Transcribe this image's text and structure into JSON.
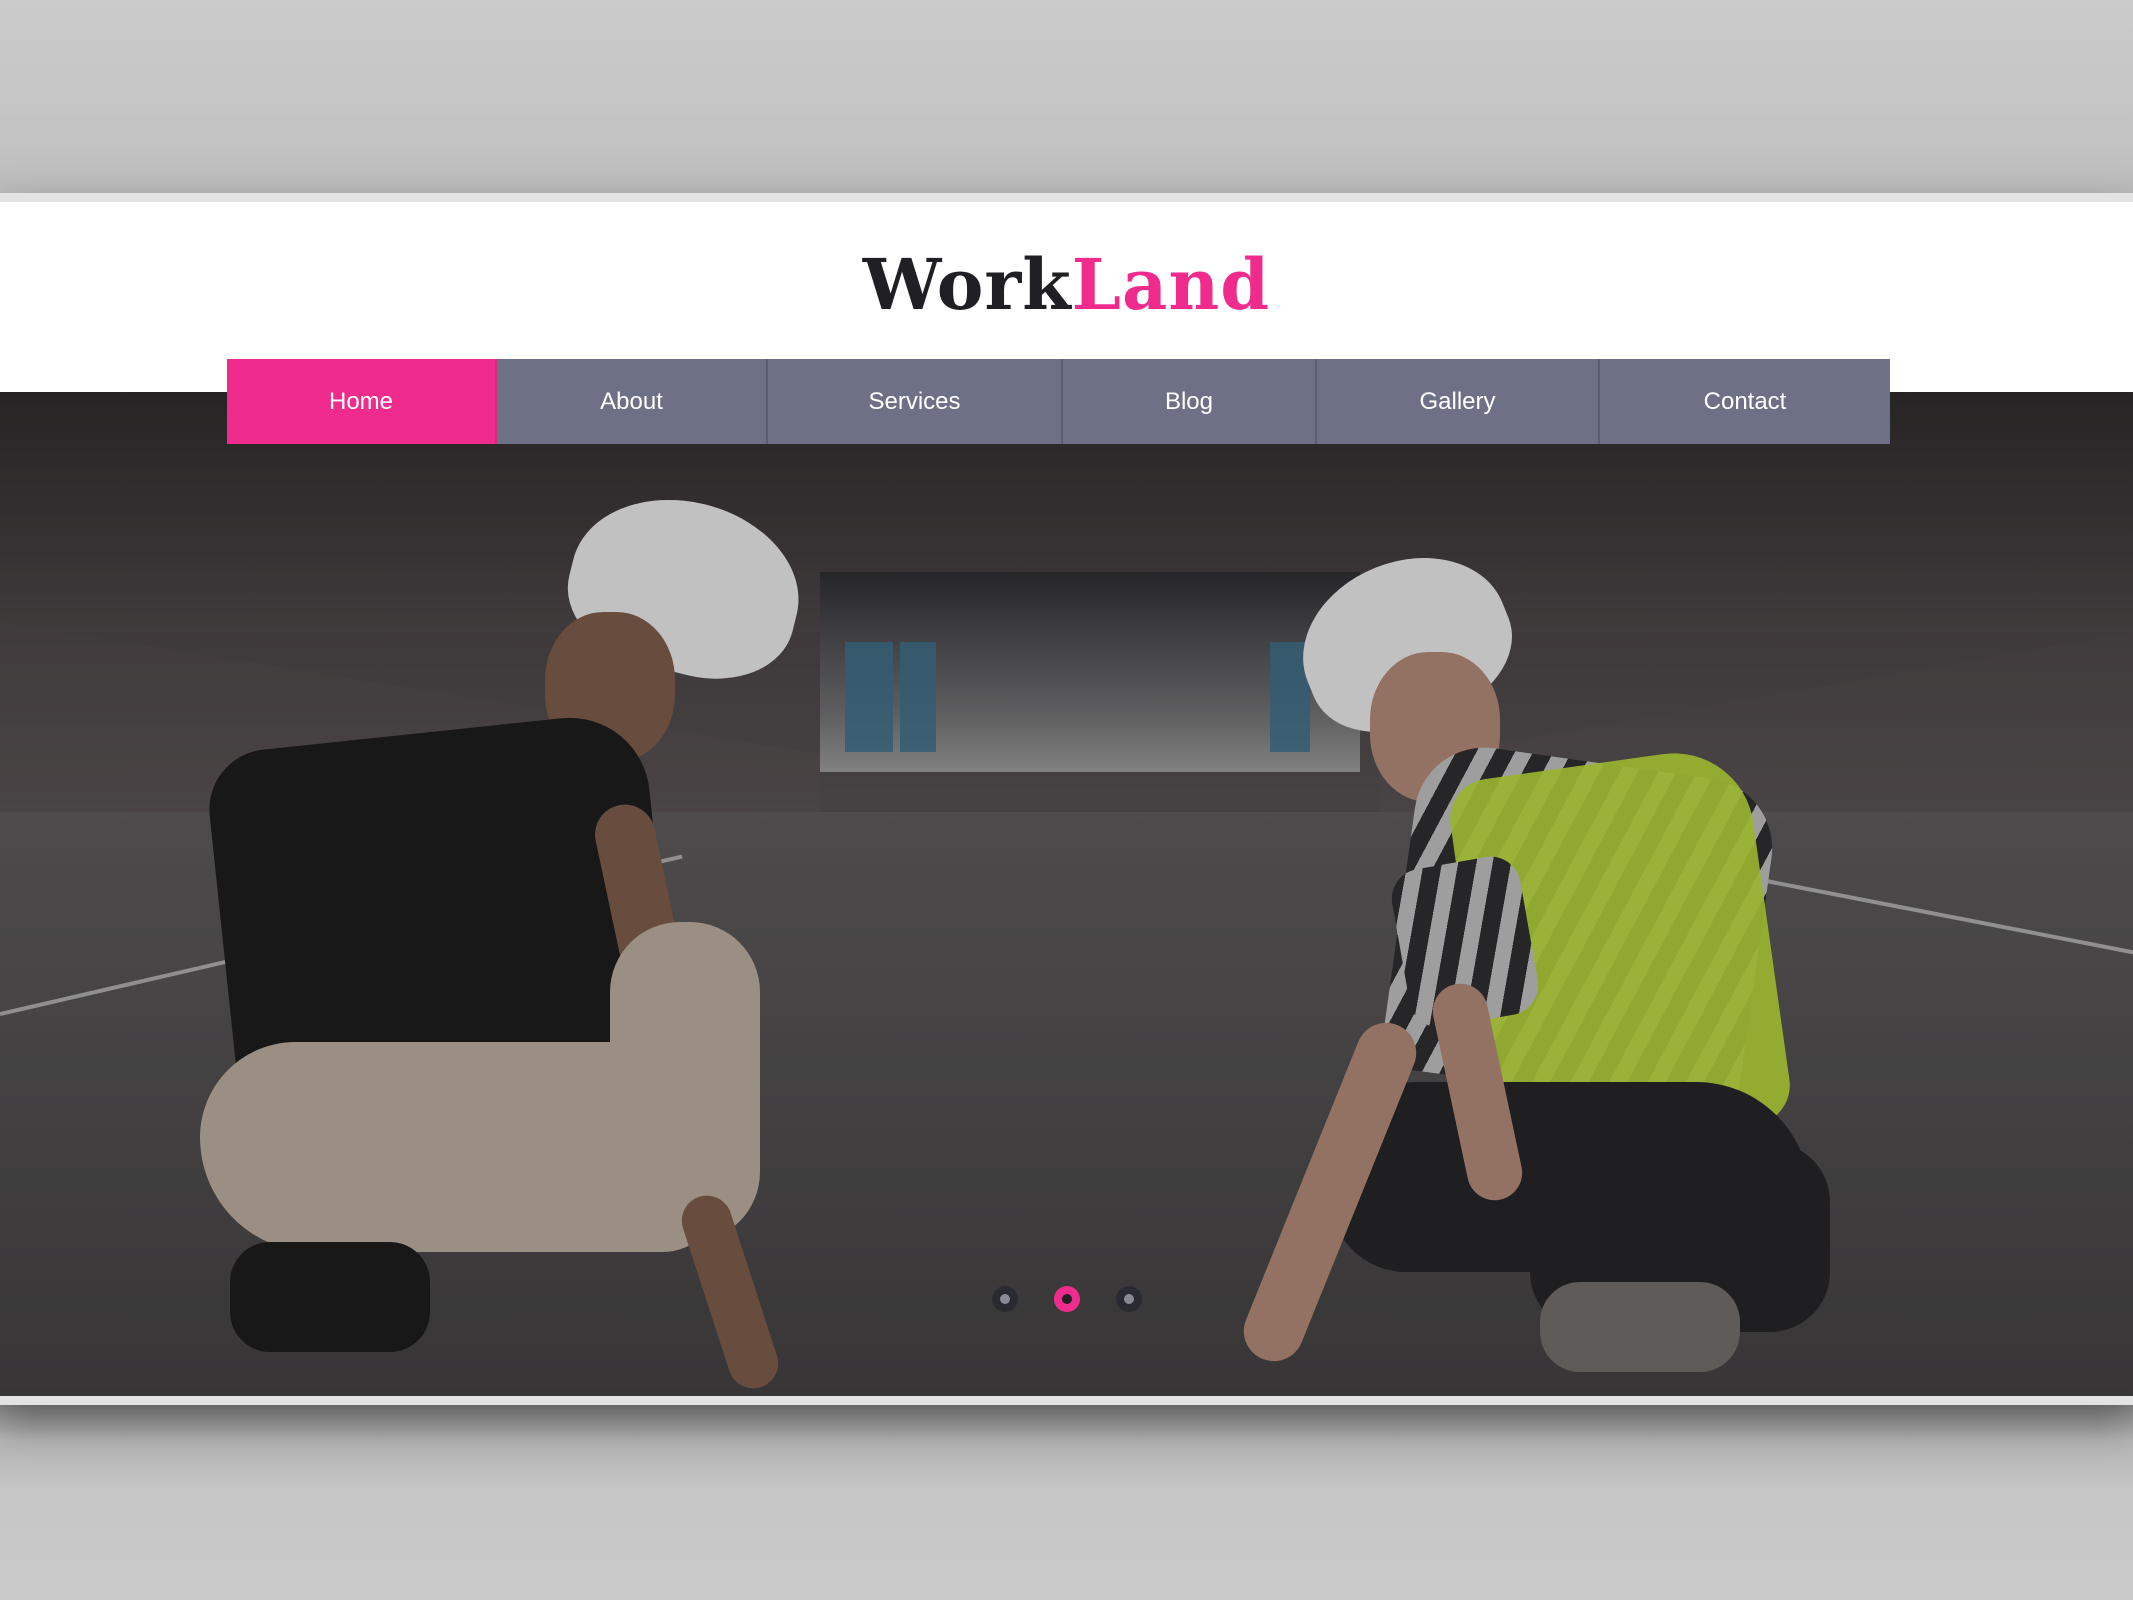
{
  "site": {
    "logo": {
      "part1": "Work",
      "part2": "Land"
    },
    "colors": {
      "accent": "#ef2c8d",
      "nav_bg": "#6e7085",
      "logo_dark": "#1f1f24"
    }
  },
  "nav": {
    "items": [
      {
        "label": "Home",
        "active": true
      },
      {
        "label": "About",
        "active": false
      },
      {
        "label": "Services",
        "active": false
      },
      {
        "label": "Blog",
        "active": false
      },
      {
        "label": "Gallery",
        "active": false
      },
      {
        "label": "Contact",
        "active": false
      }
    ]
  },
  "slider": {
    "slide_count": 3,
    "active_index": 1
  }
}
